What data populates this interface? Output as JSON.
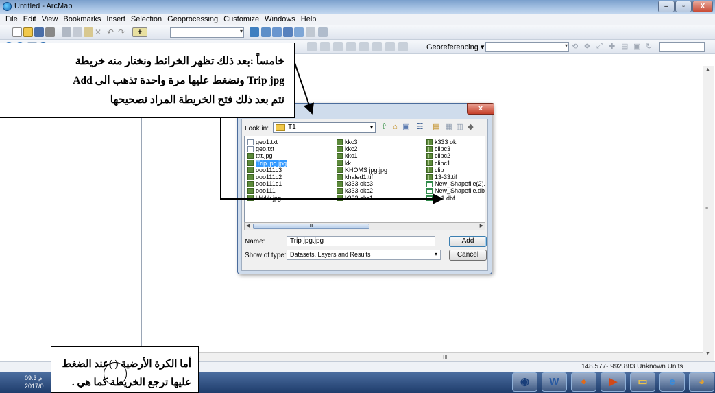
{
  "window": {
    "title": "Untitled - ArcMap",
    "minimize": "–",
    "maximize": "▫",
    "close": "X"
  },
  "menu": [
    "File",
    "Edit",
    "View",
    "Bookmarks",
    "Insert",
    "Selection",
    "Geoprocessing",
    "Customize",
    "Windows",
    "Help"
  ],
  "toolbar": {
    "georeferencing_label": "Georeferencing ▾"
  },
  "dialog": {
    "close_label": "x",
    "look_in_label": "Look in:",
    "look_in_value": "T1",
    "files_col1": [
      {
        "name": "geo1.txt",
        "type": "txt"
      },
      {
        "name": "geo.txt",
        "type": "txt"
      },
      {
        "name": "tttt.jpg",
        "type": "img"
      },
      {
        "name": "Trip jpg.jpg",
        "type": "img",
        "selected": true
      },
      {
        "name": "ooo111c3",
        "type": "img"
      },
      {
        "name": "ooo111c2",
        "type": "img"
      },
      {
        "name": "ooo111c1",
        "type": "img"
      },
      {
        "name": "ooo111",
        "type": "img"
      },
      {
        "name": "kkkkk.jpg",
        "type": "img"
      }
    ],
    "files_col2": [
      {
        "name": "kkc3",
        "type": "img"
      },
      {
        "name": "kkc2",
        "type": "img"
      },
      {
        "name": "kkc1",
        "type": "img"
      },
      {
        "name": "kk",
        "type": "img"
      },
      {
        "name": "KHOMS jpg.jpg",
        "type": "img"
      },
      {
        "name": "khaled1.tif",
        "type": "img"
      },
      {
        "name": "k333 okc3",
        "type": "img"
      },
      {
        "name": "k333 okc2",
        "type": "img"
      },
      {
        "name": "k333 okc1",
        "type": "img"
      }
    ],
    "files_col3": [
      {
        "name": "k333 ok",
        "type": "img"
      },
      {
        "name": "clipc3",
        "type": "img"
      },
      {
        "name": "clipc2",
        "type": "img"
      },
      {
        "name": "clipc1",
        "type": "img"
      },
      {
        "name": "clip",
        "type": "img"
      },
      {
        "name": "13-33.tif",
        "type": "img"
      },
      {
        "name": "New_Shapefile(2).",
        "type": "shp"
      },
      {
        "name": "New_Shapefile.db",
        "type": "shp"
      },
      {
        "name": "ko1.dbf",
        "type": "shp"
      }
    ],
    "scroll_thumb": "III",
    "name_label": "Name:",
    "name_value": "Trip jpg.jpg",
    "type_label": "Show of type:",
    "type_value": "Datasets, Layers and Results",
    "add_button": "Add",
    "cancel_button": "Cancel"
  },
  "statusbar": {
    "coords": "148.577- 992.883 Unknown Units"
  },
  "taskbar": {
    "time": "09:3 م",
    "date": "2017/0"
  },
  "annotation1": {
    "line1": "خامساً :بعد ذلك تظهر الخرائط ونختار منه خريطة",
    "line2": "Trip jpg ونضغط عليها مرة واحدة تذهب الى Add",
    "line3": "تتم بعد ذلك فتح الخريطة المراد تصحيحها"
  },
  "annotation2": {
    "line1": "أما الكرة الأرضية (   )عند الضغط",
    "line2": "عليها ترجع الخريطة كما هي ."
  },
  "colors": {
    "titlebar": "#a8c4e4",
    "taskbar": "#2c4c7c",
    "selection": "#3399ff",
    "close": "#c94a35"
  }
}
